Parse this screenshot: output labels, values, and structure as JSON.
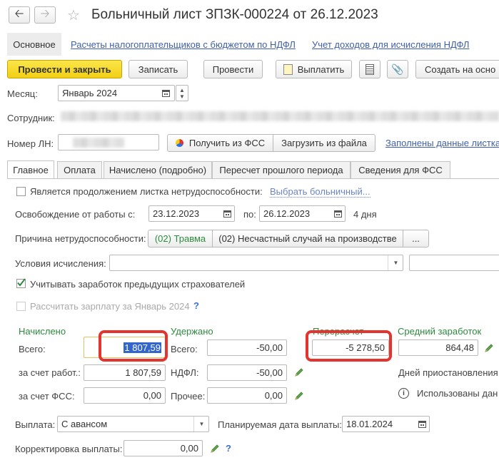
{
  "window": {
    "title": "Больничный лист ЗПЗК-000224 от 26.12.2023"
  },
  "top_nav": {
    "main": "Основное",
    "link1": "Расчеты налогоплательщиков с бюджетом по НДФЛ",
    "link2": "Учет доходов для исчисления НДФЛ"
  },
  "toolbar": {
    "post_close": "Провести и закрыть",
    "save": "Записать",
    "post": "Провести",
    "pay": "Выплатить",
    "create_based": "Создать на осно"
  },
  "header": {
    "month_label": "Месяц:",
    "month_value": "Январь 2024",
    "employee_label": "Сотрудник:",
    "ln_label": "Номер ЛН:",
    "get_fss": "Получить из ФСС",
    "load_file": "Загрузить из файла",
    "filled_link": "Заполнены данные листка"
  },
  "tabs": [
    "Главное",
    "Оплата",
    "Начислено (подробно)",
    "Пересчет прошлого периода",
    "Сведения для ФСС"
  ],
  "main": {
    "continuation_label": "Является продолжением листка нетрудоспособности:",
    "choose_sick": "Выбрать больничный...",
    "release_label": "Освобождение от работы с:",
    "date_from": "23.12.2023",
    "to_label": "по:",
    "date_to": "26.12.2023",
    "days": "4 дня",
    "cause_label": "Причина нетрудоспособности:",
    "cause_code": "(02) Травма",
    "cause_desc": "(02) Несчастный случай на производстве",
    "ellipsis": "...",
    "conditions_label": "Условия исчисления:",
    "prev_insurers_label": "Учитывать заработок предыдущих страхователей",
    "calc_salary_label": "Рассчитать зарплату за Январь 2024",
    "help_mark": "?"
  },
  "totals": {
    "accrued_header": "Начислено",
    "total_label": "Всего:",
    "accrued_total": "1 807,59",
    "employer_label": "за счет работ.:",
    "accrued_employer": "1 807,59",
    "fss_label": "за счет ФСС:",
    "accrued_fss": "0,00",
    "withheld_header": "Удержано",
    "withheld_total_label": "Всего:",
    "withheld_total": "-50,00",
    "ndfl_label": "НДФЛ:",
    "withheld_ndfl": "-50,00",
    "other_label": "Прочее:",
    "withheld_other": "0,00",
    "recalc_header": "Перерасчет",
    "recalc_value": "-5 278,50",
    "avg_header": "Средний заработок",
    "avg_value": "864,48",
    "suspension_label": "Дней приостановления",
    "used_label": "Использованы дан"
  },
  "payment": {
    "payout_label": "Выплата:",
    "payout_value": "С авансом",
    "planned_label": "Планируемая дата выплаты:",
    "planned_date": "18.01.2024",
    "correction_label": "Корректировка выплаты:",
    "correction_value": "0,00"
  },
  "colors": {
    "accent_yellow": "#f2cf14",
    "green_header": "#2d8a3e",
    "link_blue": "#4060a8",
    "highlight_red": "#e3342f",
    "selection_blue": "#3366cc"
  }
}
